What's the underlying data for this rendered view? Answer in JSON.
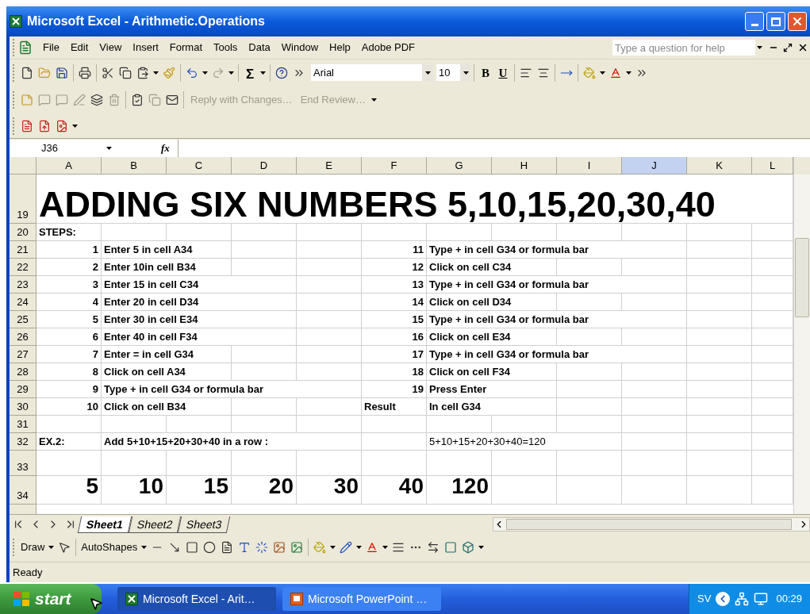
{
  "window": {
    "title": "Microsoft Excel - Arithmetic.Operations"
  },
  "menu": {
    "items": [
      "File",
      "Edit",
      "View",
      "Insert",
      "Format",
      "Tools",
      "Data",
      "Window",
      "Help",
      "Adobe PDF"
    ],
    "help_placeholder": "Type a question for help"
  },
  "standard_toolbar": {
    "sum_label": "Σ",
    "font": "Arial",
    "size": "10",
    "bold_label": "B",
    "underline_label": "U"
  },
  "reviewing_toolbar": {
    "items": [
      {
        "label": "Reply with Changes…",
        "disabled": true
      },
      {
        "label": "End Review…",
        "disabled": true
      }
    ]
  },
  "formula_bar": {
    "name_box": "J36",
    "fx_label": "fx"
  },
  "grid": {
    "columns": [
      {
        "label": "A",
        "selected": false
      },
      {
        "label": "B",
        "selected": false
      },
      {
        "label": "C",
        "selected": false
      },
      {
        "label": "D",
        "selected": false
      },
      {
        "label": "E",
        "selected": false
      },
      {
        "label": "F",
        "selected": false
      },
      {
        "label": "G",
        "selected": false
      },
      {
        "label": "H",
        "selected": false
      },
      {
        "label": "I",
        "selected": false
      },
      {
        "label": "J",
        "selected": true
      },
      {
        "label": "K",
        "selected": false
      },
      {
        "label": "L",
        "selected": false
      }
    ],
    "rows": [
      {
        "number": "19",
        "kind": "title",
        "cells": [
          {
            "text": "ADDING SIX NUMBERS 5,10,15,20,30,40",
            "bold": true
          }
        ]
      },
      {
        "number": "20",
        "kind": "normal",
        "cells": [
          {
            "text": "STEPS:",
            "bold": true
          }
        ]
      },
      {
        "number": "21",
        "kind": "normal",
        "cells": [
          {
            "text": "1",
            "bold": true
          },
          {
            "text": "Enter 5 in cell A34",
            "bold": true
          },
          {
            "text": ""
          },
          {
            "text": ""
          },
          {
            "text": ""
          },
          {
            "text": "11",
            "bold": true
          },
          {
            "text": "Type + in cell G34 or formula bar",
            "bold": true
          }
        ]
      },
      {
        "number": "22",
        "kind": "normal",
        "cells": [
          {
            "text": "2",
            "bold": true
          },
          {
            "text": "Enter 10in cell B34",
            "bold": true
          },
          {
            "text": ""
          },
          {
            "text": ""
          },
          {
            "text": ""
          },
          {
            "text": "12",
            "bold": true
          },
          {
            "text": "Click on cell C34",
            "bold": true
          }
        ]
      },
      {
        "number": "23",
        "kind": "normal",
        "cells": [
          {
            "text": "3",
            "bold": true
          },
          {
            "text": "Enter 15 in cell C34",
            "bold": true
          },
          {
            "text": ""
          },
          {
            "text": ""
          },
          {
            "text": ""
          },
          {
            "text": "13",
            "bold": true
          },
          {
            "text": "Type + in cell G34 or formula bar",
            "bold": true
          }
        ]
      },
      {
        "number": "24",
        "kind": "normal",
        "cells": [
          {
            "text": "4",
            "bold": true
          },
          {
            "text": "Enter 20 in cell D34",
            "bold": true
          },
          {
            "text": ""
          },
          {
            "text": ""
          },
          {
            "text": ""
          },
          {
            "text": "14",
            "bold": true
          },
          {
            "text": "Click on cell D34",
            "bold": true
          }
        ]
      },
      {
        "number": "25",
        "kind": "normal",
        "cells": [
          {
            "text": "5",
            "bold": true
          },
          {
            "text": "Enter 30 in cell E34",
            "bold": true
          },
          {
            "text": ""
          },
          {
            "text": ""
          },
          {
            "text": ""
          },
          {
            "text": "15",
            "bold": true
          },
          {
            "text": "Type + in cell G34 or formula bar",
            "bold": true
          }
        ]
      },
      {
        "number": "26",
        "kind": "normal",
        "cells": [
          {
            "text": "6",
            "bold": true
          },
          {
            "text": "Enter 40 in cell F34",
            "bold": true
          },
          {
            "text": ""
          },
          {
            "text": ""
          },
          {
            "text": ""
          },
          {
            "text": "16",
            "bold": true
          },
          {
            "text": "Click on cell E34",
            "bold": true
          }
        ]
      },
      {
        "number": "27",
        "kind": "normal",
        "cells": [
          {
            "text": "7",
            "bold": true
          },
          {
            "text": "Enter = in cell G34",
            "bold": true
          },
          {
            "text": ""
          },
          {
            "text": ""
          },
          {
            "text": ""
          },
          {
            "text": "17",
            "bold": true
          },
          {
            "text": "Type + in cell G34 or formula bar",
            "bold": true
          }
        ]
      },
      {
        "number": "28",
        "kind": "normal",
        "cells": [
          {
            "text": "8",
            "bold": true
          },
          {
            "text": "Click on cell A34",
            "bold": true
          },
          {
            "text": ""
          },
          {
            "text": ""
          },
          {
            "text": ""
          },
          {
            "text": "18",
            "bold": true
          },
          {
            "text": "Click on cell F34",
            "bold": true
          }
        ]
      },
      {
        "number": "29",
        "kind": "normal",
        "cells": [
          {
            "text": "9",
            "bold": true
          },
          {
            "text": "Type + in cell G34 or formula bar",
            "bold": true
          },
          {
            "text": ""
          },
          {
            "text": ""
          },
          {
            "text": ""
          },
          {
            "text": "19",
            "bold": true
          },
          {
            "text": "Press Enter",
            "bold": true
          }
        ]
      },
      {
        "number": "30",
        "kind": "normal",
        "cells": [
          {
            "text": "10",
            "bold": true
          },
          {
            "text": "Click on cell B34",
            "bold": true
          },
          {
            "text": ""
          },
          {
            "text": ""
          },
          {
            "text": ""
          },
          {
            "text": "Result",
            "bold": true
          },
          {
            "text": "In cell G34",
            "bold": true
          }
        ]
      },
      {
        "number": "31",
        "kind": "normal",
        "cells": []
      },
      {
        "number": "32",
        "kind": "normal",
        "cells": [
          {
            "text": "EX.2:",
            "bold": true
          },
          {
            "text": "Add 5+10+15+20+30+40 in a row :",
            "bold": true
          },
          {
            "text": ""
          },
          {
            "text": ""
          },
          {
            "text": ""
          },
          {
            "text": ""
          },
          {
            "text": "5+10+15+20+30+40=120",
            "bold": false
          }
        ]
      },
      {
        "number": "33",
        "kind": "spacer",
        "cells": []
      },
      {
        "number": "34",
        "kind": "large",
        "cells": [
          {
            "text": "5",
            "bold": true
          },
          {
            "text": "10",
            "bold": true
          },
          {
            "text": "15",
            "bold": true
          },
          {
            "text": "20",
            "bold": true
          },
          {
            "text": "30",
            "bold": true
          },
          {
            "text": "40",
            "bold": true
          },
          {
            "text": "120",
            "bold": true
          }
        ]
      }
    ]
  },
  "sheet_tabs": [
    {
      "label": "Sheet1",
      "selected": true
    },
    {
      "label": "Sheet2",
      "selected": false
    },
    {
      "label": "Sheet3",
      "selected": false
    }
  ],
  "drawing_toolbar": {
    "draw_label": "Draw",
    "autoshapes_label": "AutoShapes"
  },
  "status_bar": {
    "text": "Ready"
  },
  "taskbar": {
    "start_label": "start",
    "tasks": [
      {
        "label": "Microsoft Excel - Arit…",
        "kind": "excel",
        "selected": true
      },
      {
        "label": "Microsoft PowerPoint …",
        "kind": "powerpoint",
        "selected": false
      }
    ],
    "language": "SV",
    "time": "00:29"
  }
}
